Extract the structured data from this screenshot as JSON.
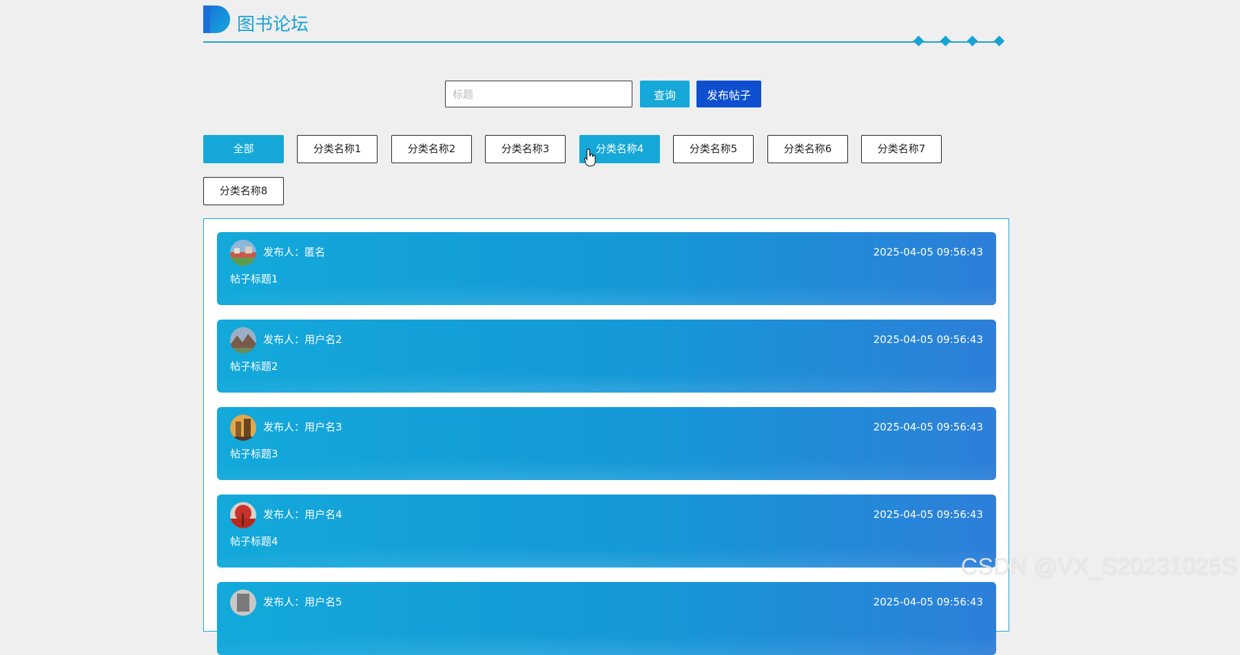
{
  "header": {
    "title": "图书论坛"
  },
  "search": {
    "placeholder": "标题",
    "value": "",
    "query_label": "查询",
    "publish_label": "发布帖子"
  },
  "categories": [
    {
      "label": "全部",
      "active": true
    },
    {
      "label": "分类名称1",
      "active": false
    },
    {
      "label": "分类名称2",
      "active": false
    },
    {
      "label": "分类名称3",
      "active": false
    },
    {
      "label": "分类名称4",
      "active": true
    },
    {
      "label": "分类名称5",
      "active": false
    },
    {
      "label": "分类名称6",
      "active": false
    },
    {
      "label": "分类名称7",
      "active": false
    },
    {
      "label": "分类名称8",
      "active": false
    }
  ],
  "posts": [
    {
      "author": "发布人：匿名",
      "date": "2025-04-05 09:56:43",
      "title": "帖子标题1"
    },
    {
      "author": "发布人：用户名2",
      "date": "2025-04-05 09:56:43",
      "title": "帖子标题2"
    },
    {
      "author": "发布人：用户名3",
      "date": "2025-04-05 09:56:43",
      "title": "帖子标题3"
    },
    {
      "author": "发布人：用户名4",
      "date": "2025-04-05 09:56:43",
      "title": "帖子标题4"
    },
    {
      "author": "发布人：用户名5",
      "date": "2025-04-05 09:56:43",
      "title": ""
    }
  ],
  "colors": {
    "accent": "#15a8d9",
    "publish": "#0d4fcf",
    "background": "#efefef"
  },
  "watermark": "CSDN @VX_S20231025S"
}
